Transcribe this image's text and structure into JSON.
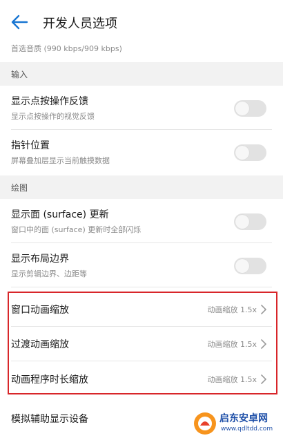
{
  "header": {
    "title": "开发人员选项",
    "back_icon": "arrow-left-icon"
  },
  "colors": {
    "accent": "#1976d2",
    "highlight_box": "#d8262a",
    "toggle_off": "#e2e2e2",
    "watermark": "#1e4fa8"
  },
  "cut_row": {
    "subtitle": "首选音质 (990 kbps/909 kbps)"
  },
  "sections": {
    "input": {
      "label": "输入"
    },
    "drawing": {
      "label": "绘图"
    }
  },
  "input_rows": [
    {
      "title": "显示点按操作反馈",
      "subtitle": "显示点按操作的视觉反馈",
      "toggle_on": false
    },
    {
      "title": "指针位置",
      "subtitle": "屏幕叠加层显示当前触摸数据",
      "toggle_on": false
    }
  ],
  "drawing_rows": [
    {
      "title": "显示面 (surface) 更新",
      "subtitle": "窗口中的面 (surface) 更新时全部闪烁",
      "toggle_on": false
    },
    {
      "title": "显示布局边界",
      "subtitle": "显示剪辑边界、边距等",
      "toggle_on": false
    }
  ],
  "animation_rows": [
    {
      "title": "窗口动画缩放",
      "value": "动画缩放 1.5x"
    },
    {
      "title": "过渡动画缩放",
      "value": "动画缩放 1.5x"
    },
    {
      "title": "动画程序时长缩放",
      "value": "动画缩放 1.5x"
    }
  ],
  "last_row": {
    "title": "模拟辅助显示设备"
  },
  "watermark": {
    "name": "启东安卓网",
    "url": "www.qdltdd.com"
  }
}
